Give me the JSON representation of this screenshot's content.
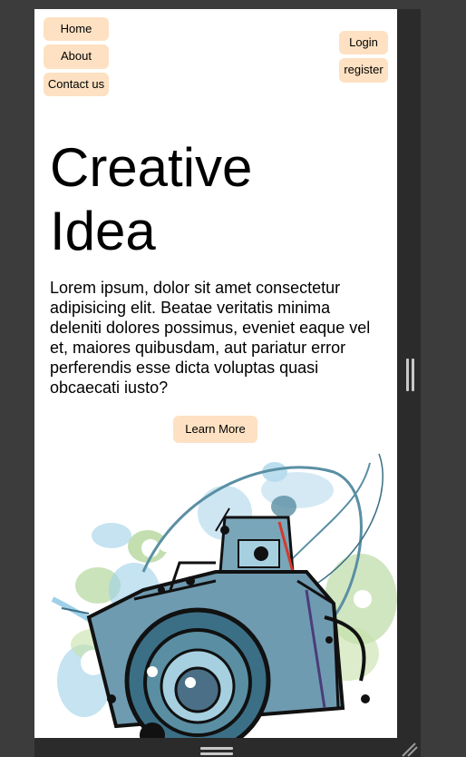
{
  "nav": {
    "left": [
      "Home",
      "About",
      "Contact us"
    ],
    "right": [
      "Login",
      "register"
    ]
  },
  "hero": {
    "title_line1": "Creative",
    "title_line2": "Idea",
    "paragraph": "Lorem ipsum, dolor sit amet consectetur adipisicing elit. Beatae veritatis minima deleniti dolores possimus, eveniet eaque vel et, maiores quibusdam, aut pariatur error perferendis esse dicta voluptas quasi obcaecati iusto?",
    "cta_label": "Learn More"
  },
  "illustration": {
    "icon": "camera-sketch-illustration"
  },
  "colors": {
    "button_bg": "#fde1c2",
    "page_bg": "#ffffff",
    "devtools_bg": "#3c3c3c",
    "panel_bg": "#2b2b2b"
  }
}
